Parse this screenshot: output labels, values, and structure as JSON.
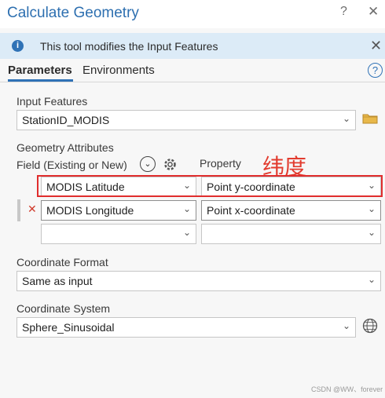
{
  "window": {
    "title": "Calculate Geometry",
    "help_label": "?",
    "close_label": "✕"
  },
  "banner": {
    "text": "This tool modifies the Input Features"
  },
  "tabs": [
    {
      "label": "Parameters",
      "active": true
    },
    {
      "label": "Environments",
      "active": false
    }
  ],
  "input_features": {
    "label": "Input Features",
    "value": "StationID_MODIS"
  },
  "geometry_attributes": {
    "label": "Geometry Attributes",
    "field_header": "Field (Existing or New)",
    "property_header": "Property",
    "rows": [
      {
        "field": "MODIS Latitude",
        "property": "Point y-coordinate"
      },
      {
        "field": "MODIS Longitude",
        "property": "Point x-coordinate"
      },
      {
        "field": "",
        "property": ""
      }
    ]
  },
  "annotation": {
    "text": "纬度",
    "color": "#e23b2e"
  },
  "coordinate_format": {
    "label": "Coordinate Format",
    "value": "Same as input"
  },
  "coordinate_system": {
    "label": "Coordinate System",
    "value": "Sphere_Sinusoidal"
  },
  "watermark": "CSDN @WW、forever",
  "colors": {
    "accent": "#2f72b6",
    "title": "#2d6fb0",
    "banner_bg": "#dcebf7",
    "highlight": "#e02d2d"
  },
  "icons": [
    "info-icon",
    "close-icon",
    "help-icon",
    "folder-icon",
    "chevron-down-icon",
    "gear-icon",
    "remove-icon",
    "globe-icon"
  ]
}
